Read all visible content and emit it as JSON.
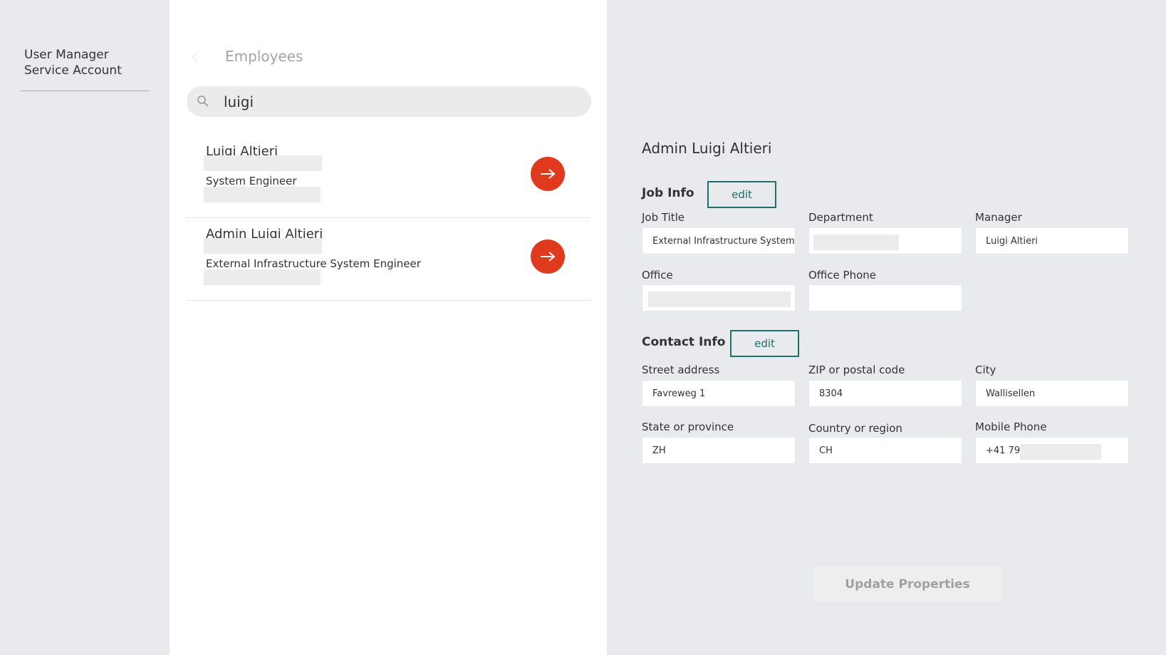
{
  "account": {
    "line1": "User Manager",
    "line2": "Service Account"
  },
  "employees": {
    "title": "Employees",
    "search_value": "luigi",
    "results": [
      {
        "name": "Luigi Altieri",
        "job_title": "System Engineer"
      },
      {
        "name": "Admin Luigi Altieri",
        "job_title": "External Infrastructure System Engineer"
      }
    ]
  },
  "detail": {
    "name": "Admin Luigi Altieri",
    "job_info": {
      "heading": "Job Info",
      "edit_label": "edit",
      "job_title_label": "Job Title",
      "job_title_value": "External Infrastructure System E",
      "department_label": "Department",
      "department_value": "",
      "manager_label": "Manager",
      "manager_value": "Luigi Altieri",
      "office_label": "Office",
      "office_value": "",
      "office_phone_label": "Office Phone",
      "office_phone_value": ""
    },
    "contact_info": {
      "heading": "Contact Info",
      "edit_label": "edit",
      "street_label": "Street address",
      "street_value": "Favreweg 1",
      "zip_label": "ZIP or postal code",
      "zip_value": "8304",
      "city_label": "City",
      "city_value": "Wallisellen",
      "state_label": "State or province",
      "state_value": "ZH",
      "country_label": "Country or region",
      "country_value": "CH",
      "mobile_label": "Mobile Phone",
      "mobile_value": "+41 79"
    },
    "update_label": "Update Properties"
  },
  "icons": {
    "search": "search-icon",
    "arrow": "arrow-right-icon",
    "back": "chevron-left-icon"
  },
  "colors": {
    "accent_red": "#e03a1e",
    "accent_teal": "#1e6f6a",
    "background": "#e9eaed"
  }
}
